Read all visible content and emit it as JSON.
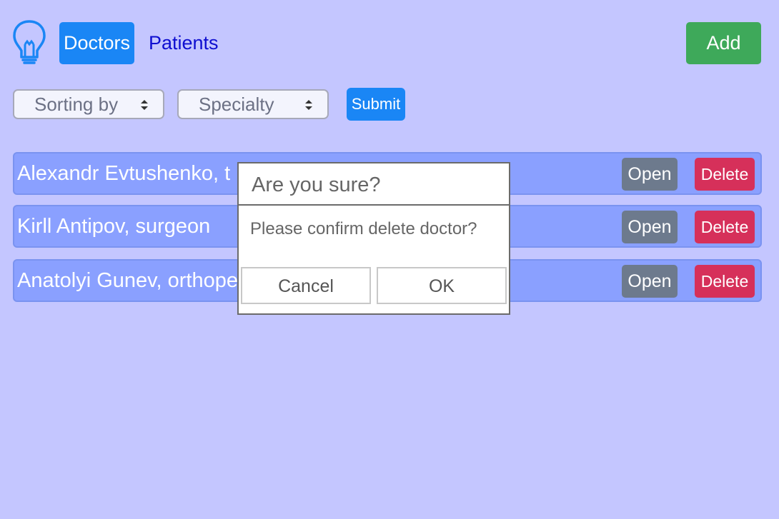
{
  "nav": {
    "logo_icon": "lightbulb-icon",
    "doctors_label": "Doctors",
    "patients_label": "Patients",
    "add_label": "Add"
  },
  "filters": {
    "sort_value": "Sorting by",
    "specialty_value": "Specialty",
    "submit_label": "Submit"
  },
  "doctors": [
    {
      "name": "Alexandr Evtushenko, t",
      "open_label": "Open",
      "delete_label": "Delete"
    },
    {
      "name": "Kirll Antipov, surgeon",
      "open_label": "Open",
      "delete_label": "Delete"
    },
    {
      "name": "Anatolyi Gunev, orthope",
      "open_label": "Open",
      "delete_label": "Delete"
    }
  ],
  "dialog": {
    "title": "Are you sure?",
    "message": "Please confirm delete doctor?",
    "cancel_label": "Cancel",
    "ok_label": "OK"
  },
  "colors": {
    "background": "#c4c6ff",
    "primary": "#1a86f5",
    "success": "#3ea95a",
    "danger": "#d6305a",
    "secondary": "#6d7a8d",
    "row": "#8aa0ff"
  }
}
